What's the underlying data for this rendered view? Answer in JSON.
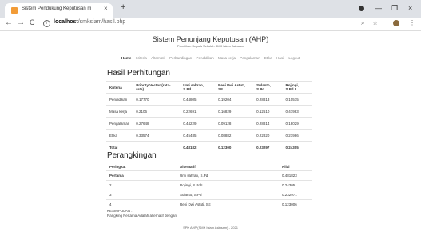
{
  "browser": {
    "tab_title": "Sistem Pendukung Keputusan m",
    "tab_close": "×",
    "new_tab": "+",
    "url_host": "localhost",
    "url_path": "/smksiam/hasil.php",
    "back": "←",
    "forward": "→",
    "reload": "C",
    "zoom_icon": "⌕",
    "star_icon": "☆",
    "menu_icon": "⋮",
    "minimize": "—",
    "maximize": "❐",
    "close": "×"
  },
  "header": {
    "title": "Sistem Penunjang Keputusan (AHP)",
    "subtitle": "Pemilihan Kepala Sekolah SMK Islam Aslusam"
  },
  "nav_menu": {
    "items": [
      "Home",
      "Kriteria",
      "Alternatif",
      "Perbandingan",
      "Pendidikan",
      "Masa kerja",
      "Pengalaman",
      "Etika",
      "Hasil",
      "Logout"
    ]
  },
  "hasil": {
    "title": "Hasil Perhitungan",
    "headers": [
      "Kriteria",
      "Priority Vector (rata-rata)",
      "Umi sahrah, S.Pd",
      "Reni Dwi Astuti, SE",
      "Sulanto, S.Pd",
      "Rojingi, S.Pd.I"
    ],
    "rows": [
      [
        "Pendidikan",
        "0.17770",
        "0.44805",
        "0.19204",
        "0.28813",
        "0.10515"
      ],
      [
        "Masa kerja",
        "0.2106",
        "0.22691",
        "0.16829",
        "0.12510",
        "0.47983"
      ],
      [
        "Pengalaman",
        "0.27648",
        "0.44229",
        "0.09128",
        "0.28814",
        "0.18029"
      ],
      [
        "Etika",
        "0.33574",
        "0.45485",
        "0.08882",
        "0.22820",
        "0.21986"
      ]
    ],
    "total": [
      "Total",
      "",
      "0.48182",
      "0.12300",
      "0.23297",
      "0.24305"
    ]
  },
  "ranking": {
    "title": "Perangkingan",
    "headers": [
      "Peringkat",
      "Alternatif",
      "Nilai"
    ],
    "rows": [
      [
        "Pertama",
        "Umi sahrah, S.Pd",
        "0.481823"
      ],
      [
        "2",
        "Rojingi, S.Pd.I",
        "0.24305"
      ],
      [
        "3",
        "Sulanto, S.Pd",
        "0.232971"
      ],
      [
        "4",
        "Reni Dwi Astuti, SE",
        "0.123006"
      ]
    ]
  },
  "conclusion": {
    "label": "KESIMPULAN :",
    "text": "Rangking Pertama Adalah alternatif dengan"
  },
  "footer": {
    "text": "SPK AHP (SMK Islam Aslusam) - 2021"
  }
}
